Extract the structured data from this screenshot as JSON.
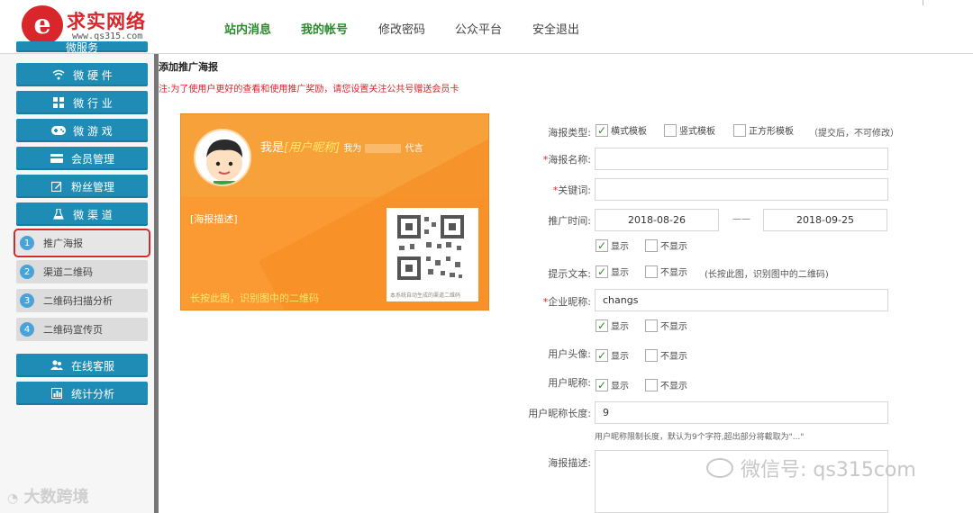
{
  "header": {
    "logo_glyph": "e",
    "logo_name": "求实网络",
    "logo_url": "www.qs315.com",
    "nav": [
      {
        "label": "站内消息",
        "active": true
      },
      {
        "label": "我的帐号",
        "active": true
      },
      {
        "label": "修改密码",
        "active": false
      },
      {
        "label": "公众平台",
        "active": false
      },
      {
        "label": "安全退出",
        "active": false
      }
    ]
  },
  "sidebar": {
    "top_partial": "微服务",
    "menu": [
      {
        "label": "微 硬 件",
        "icon": "wifi-icon"
      },
      {
        "label": "微 行 业",
        "icon": "grid-icon"
      },
      {
        "label": "微 游 戏",
        "icon": "gamepad-icon"
      },
      {
        "label": "会员管理",
        "icon": "card-icon"
      },
      {
        "label": "粉丝管理",
        "icon": "edit-icon"
      },
      {
        "label": "微 渠 道",
        "icon": "flask-icon"
      }
    ],
    "submenu": [
      {
        "num": "1",
        "label": "推广海报"
      },
      {
        "num": "2",
        "label": "渠道二维码"
      },
      {
        "num": "3",
        "label": "二维码扫描分析"
      },
      {
        "num": "4",
        "label": "二维码宣传页"
      }
    ],
    "bottom": [
      {
        "label": "在线客服",
        "icon": "users-icon"
      },
      {
        "label": "统计分析",
        "icon": "bar-chart-icon"
      }
    ],
    "watermark": "大数跨境"
  },
  "main": {
    "title": "添加推广海报",
    "notice": "注:为了使用户更好的查看和使用推广奖励，请您设置关注公共号赠送会员卡",
    "preview": {
      "greet_prefix": "我是",
      "greet_placeholder": "[用户昵称]",
      "greet_suffix": "我为",
      "greet_end": "代言",
      "desc": "[海报描述]",
      "longpress": "长按此图，识别图中的二维码",
      "qr_caption": "本系统自动生成的渠道二维码"
    },
    "form": {
      "type_label": "海报类型:",
      "type_options": [
        {
          "label": "横式模板",
          "checked": true
        },
        {
          "label": "竖式模板",
          "checked": false
        },
        {
          "label": "正方形模板",
          "checked": false
        }
      ],
      "type_note": "（提交后，不可修改）",
      "name_label": "海报名称:",
      "name_value": "",
      "keyword_label": "关键词:",
      "keyword_value": "",
      "time_label": "推广时间:",
      "start_date": "2018-08-26",
      "date_sep": "——",
      "end_date": "2018-09-25",
      "show": "显示",
      "hide": "不显示",
      "tip_label": "提示文本:",
      "tip_note": "(长按此图，识别图中的二维码)",
      "company_label": "企业昵称:",
      "company_value": "changs",
      "avatar_label": "用户头像:",
      "nick_label": "用户昵称:",
      "nick_len_label": "用户昵称长度:",
      "nick_len_value": "9",
      "nick_len_hint": "用户昵称限制长度，默认为9个字符,超出部分将截取为\"...\"",
      "desc_label": "海报描述:"
    },
    "watermark": "微信号: qs315com"
  },
  "colors": {
    "brand_red": "#d9262b",
    "sidebar_blue": "#1f8cb5",
    "nav_green": "#2b8a2b",
    "poster_orange": "#fb9a33"
  }
}
